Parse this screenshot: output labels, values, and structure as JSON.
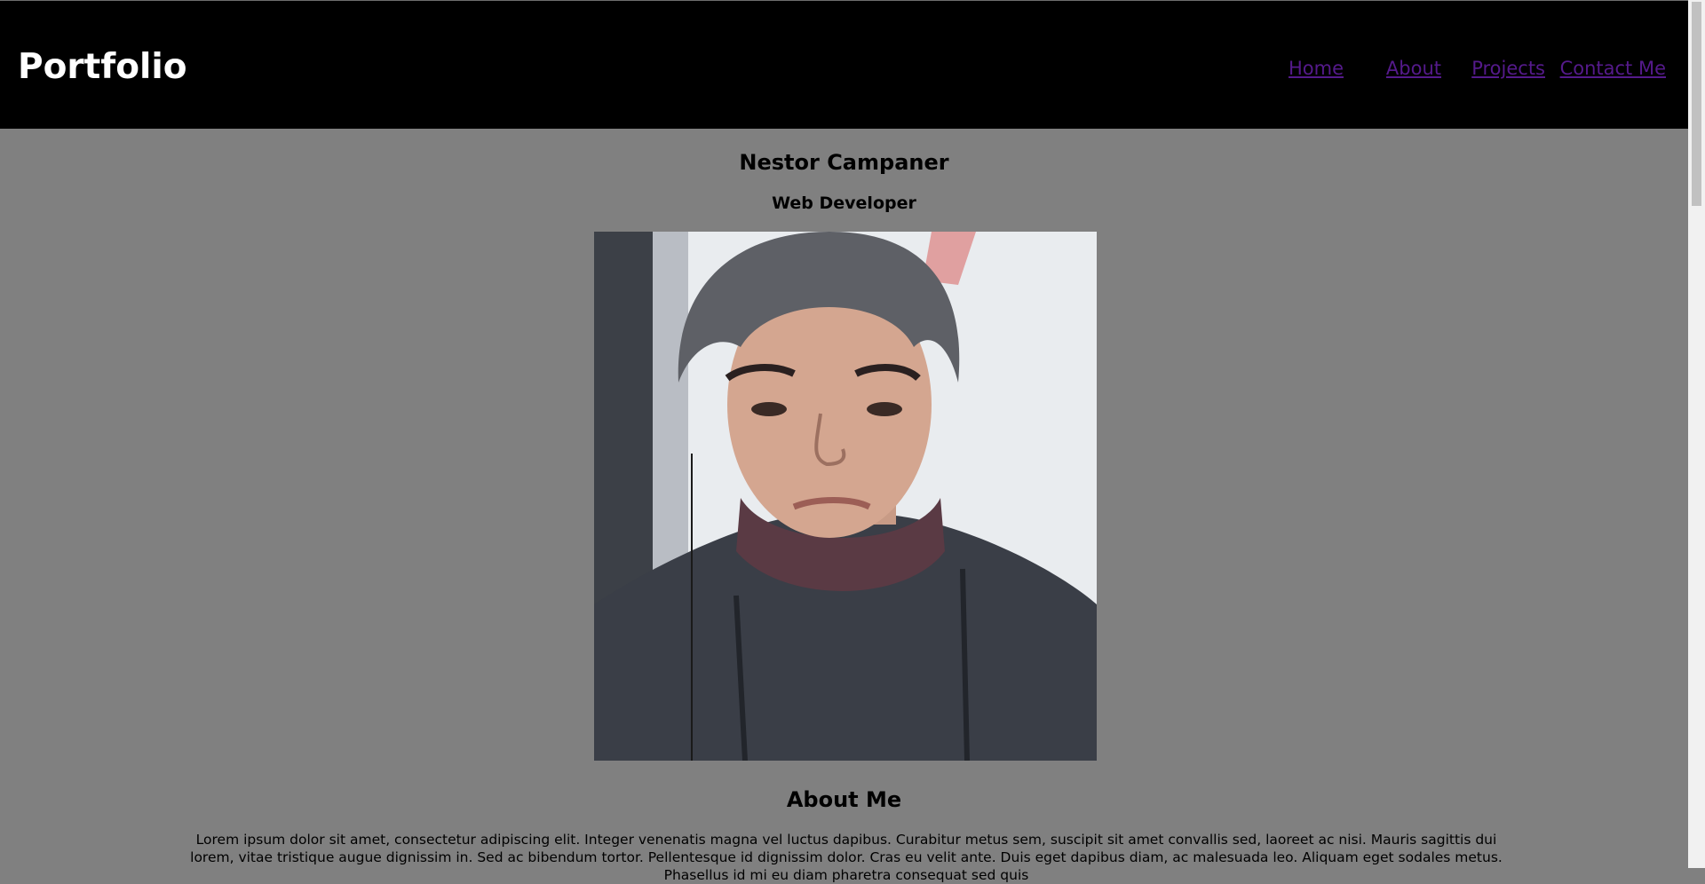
{
  "header": {
    "logo": "Portfolio",
    "nav": [
      {
        "label": "Home"
      },
      {
        "label": "About"
      },
      {
        "label": "Projects"
      },
      {
        "label": "Contact Me"
      }
    ]
  },
  "profile": {
    "name": "Nestor Campaner",
    "title": "Web Developer",
    "photo_icon": "profile-photo"
  },
  "about": {
    "heading": "About Me",
    "text": "Lorem ipsum dolor sit amet, consectetur adipiscing elit. Integer venenatis magna vel luctus dapibus. Curabitur metus sem, suscipit sit amet convallis sed, laoreet ac nisi. Mauris sagittis dui lorem, vitae tristique augue dignissim in. Sed ac bibendum tortor. Pellentesque id dignissim dolor. Cras eu velit ante. Duis eget dapibus diam, ac malesuada leo. Aliquam eget sodales metus. Phasellus id mi eu diam pharetra consequat sed quis"
  },
  "colors": {
    "header_bg": "#000000",
    "page_bg": "#808080",
    "link": "#551a8b",
    "logo": "#ffffff"
  }
}
